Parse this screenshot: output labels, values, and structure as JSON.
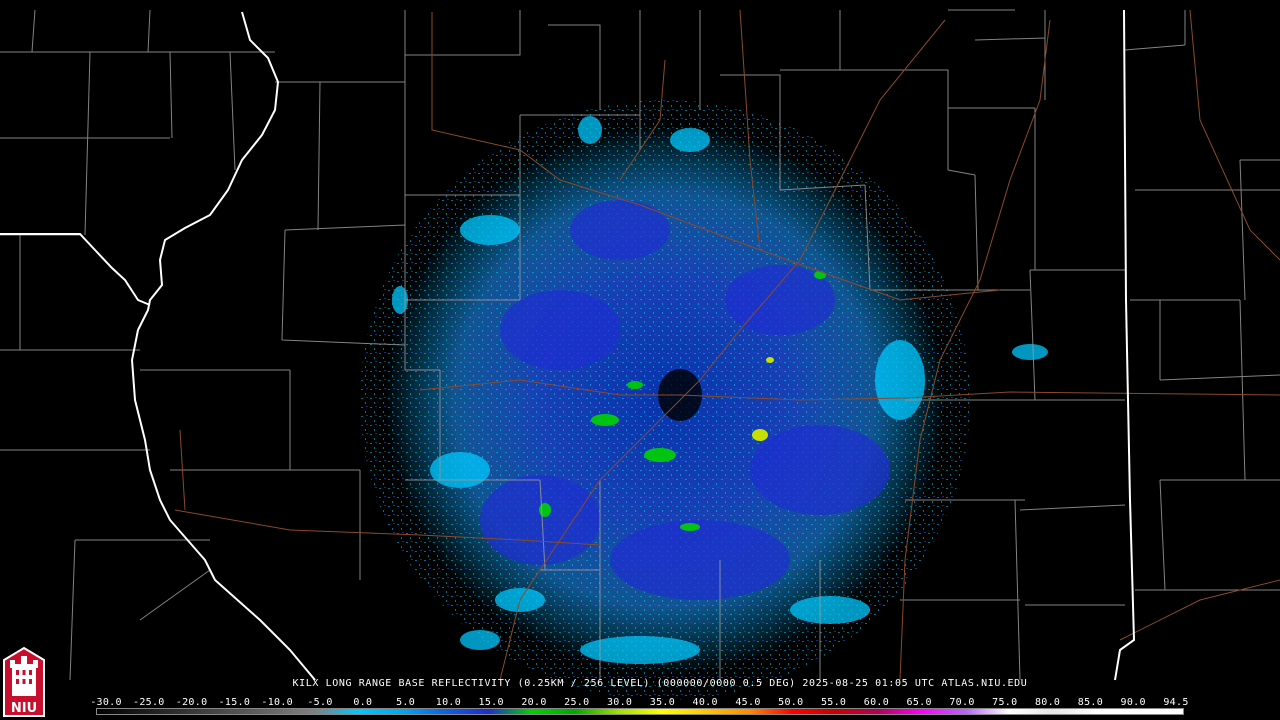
{
  "caption": {
    "text": "KILX LONG RANGE BASE REFLECTIVITY (0.25KM / 256 LEVEL) (000000/0000 0.5 DEG) 2025-08-25 01:05 UTC  ATLAS.NIU.EDU"
  },
  "legend": {
    "tick_labels": [
      "-30.0",
      "-25.0",
      "-20.0",
      "-15.0",
      "-10.0",
      "-5.0",
      "0.0",
      "5.0",
      "10.0",
      "15.0",
      "20.0",
      "25.0",
      "30.0",
      "35.0",
      "40.0",
      "45.0",
      "50.0",
      "55.0",
      "60.0",
      "65.0",
      "70.0",
      "75.0",
      "80.0",
      "85.0",
      "90.0",
      "94.5"
    ],
    "colors": [
      "#000000",
      "#1a1a1a",
      "#333333",
      "#4d4d4d",
      "#666666",
      "#808080",
      "#00c8ff",
      "#00a8f0",
      "#0a64e6",
      "#1e2dd2",
      "#00d200",
      "#00a800",
      "#a0e000",
      "#ffff00",
      "#ffc800",
      "#ff8c00",
      "#ff0000",
      "#c80000",
      "#b4005a",
      "#ff00ff",
      "#b464ff",
      "#ffffff",
      "#e6e6e6",
      "#ffffff",
      "#ffffff",
      "#ffffff"
    ]
  },
  "logo": {
    "text": "NIU",
    "colors": {
      "border": "#ffffff",
      "fill": "#c8102e",
      "tower": "#ffffff"
    }
  },
  "map": {
    "colors": {
      "state_border": "#ffffff",
      "county_border": "#9a9a9a",
      "highway": "#8b4a2a",
      "reflectivity_low": "#00c8ff",
      "reflectivity_mid": "#1e2dd2",
      "reflectivity_green": "#00d200",
      "reflectivity_yellow": "#ffff00"
    }
  }
}
